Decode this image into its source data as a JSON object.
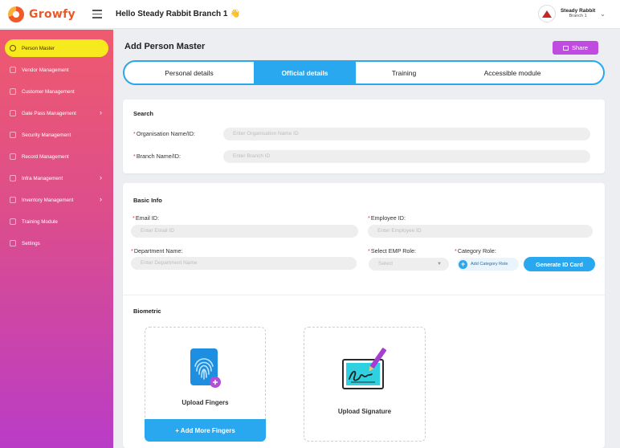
{
  "app": {
    "logo_text": "Growfy",
    "greeting": "Hello Steady Rabbit Branch 1",
    "greeting_emoji": "👋"
  },
  "user": {
    "name": "Steady Rabbit",
    "branch": "Branch 1"
  },
  "sidebar": {
    "items": [
      {
        "label": "Person Master",
        "active": true,
        "has_submenu": false,
        "icon": "person-icon"
      },
      {
        "label": "Vendor Management",
        "active": false,
        "has_submenu": false,
        "icon": "vendor-icon"
      },
      {
        "label": "Customer Management",
        "active": false,
        "has_submenu": false,
        "icon": "customer-icon"
      },
      {
        "label": "Gate Pass Management",
        "active": false,
        "has_submenu": true,
        "icon": "gate-pass-icon"
      },
      {
        "label": "Security Management",
        "active": false,
        "has_submenu": false,
        "icon": "shield-icon"
      },
      {
        "label": "Record Management",
        "active": false,
        "has_submenu": false,
        "icon": "record-icon"
      },
      {
        "label": "Infra Management",
        "active": false,
        "has_submenu": true,
        "icon": "infra-icon"
      },
      {
        "label": "Inventory Management",
        "active": false,
        "has_submenu": true,
        "icon": "inventory-icon"
      },
      {
        "label": "Training Module",
        "active": false,
        "has_submenu": false,
        "icon": "training-icon"
      },
      {
        "label": "Settings",
        "active": false,
        "has_submenu": false,
        "icon": "gear-icon"
      }
    ]
  },
  "main": {
    "title": "Add Person Master",
    "share_label": "Share",
    "tabs": [
      {
        "label": "Personal details",
        "active": false
      },
      {
        "label": "Official details",
        "active": true
      },
      {
        "label": "Training",
        "active": false
      },
      {
        "label": "Accessible module",
        "active": false
      }
    ]
  },
  "search": {
    "title": "Search",
    "org_label": "Organisation Name/ID:",
    "org_placeholder": "Enter Organisation Name ID",
    "branch_label": "Branch Name/ID:",
    "branch_placeholder": "Enter Branch ID"
  },
  "basic_info": {
    "title": "Basic Info",
    "email_label": "Email ID:",
    "email_placeholder": "Enter Email ID",
    "employee_label": "Employee ID:",
    "employee_placeholder": "Enter Employee ID",
    "department_label": "Department Name:",
    "department_placeholder": "Enter Department Name",
    "emp_role_label": "Select EMP Role:",
    "emp_role_value": "Select",
    "category_label": "Category Role:",
    "add_category_label": "Add Category Role",
    "generate_label": "Generate ID Card"
  },
  "biometric": {
    "title": "Biometric",
    "fingers_label": "Upload Fingers",
    "add_more_label": "+ Add More Fingers",
    "signature_label": "Upload Signature"
  },
  "colors": {
    "accent_blue": "#29a7ef",
    "active_yellow": "#f6ea1e",
    "share_purple": "#c04be0",
    "required_red": "#e53935"
  }
}
